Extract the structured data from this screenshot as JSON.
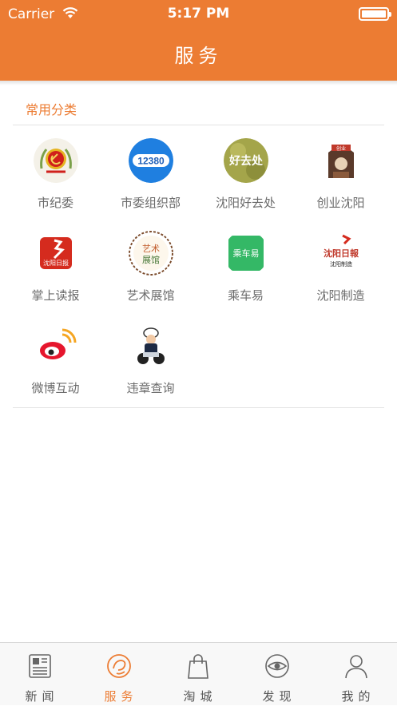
{
  "status_bar": {
    "carrier": "Carrier",
    "time": "5:17 PM"
  },
  "header": {
    "title": "服务"
  },
  "section": {
    "title": "常用分类"
  },
  "categories": [
    {
      "label": "市纪委",
      "icon": "party-emblem-icon"
    },
    {
      "label": "市委组织部",
      "icon": "12380-icon",
      "icon_text": "12380"
    },
    {
      "label": "沈阳好去处",
      "icon": "haoquchu-icon",
      "icon_text": "好去处"
    },
    {
      "label": "创业沈阳",
      "icon": "startup-icon",
      "icon_text": "创业"
    },
    {
      "label": "掌上读报",
      "icon": "shenyang-daily-icon",
      "icon_text": "沈阳日报"
    },
    {
      "label": "艺术展馆",
      "icon": "art-gallery-icon",
      "icon_text": "艺术展馆"
    },
    {
      "label": "乘车易",
      "icon": "bus-icon",
      "icon_text": "乘车易"
    },
    {
      "label": "沈阳制造",
      "icon": "shenyang-made-icon",
      "icon_text": "沈阳日報",
      "icon_subtext": "沈阳制造"
    },
    {
      "label": "微博互动",
      "icon": "weibo-icon"
    },
    {
      "label": "违章查询",
      "icon": "traffic-police-icon"
    }
  ],
  "tabs": [
    {
      "label": "新闻",
      "icon": "newspaper-icon",
      "active": false
    },
    {
      "label": "服务",
      "icon": "service-icon",
      "active": true
    },
    {
      "label": "淘城",
      "icon": "shopping-bag-icon",
      "active": false
    },
    {
      "label": "发现",
      "icon": "eye-icon",
      "active": false
    },
    {
      "label": "我的",
      "icon": "person-icon",
      "active": false
    }
  ],
  "colors": {
    "accent": "#ec7c33",
    "label_gray": "#6b6b6b",
    "tab_gray": "#555555"
  }
}
